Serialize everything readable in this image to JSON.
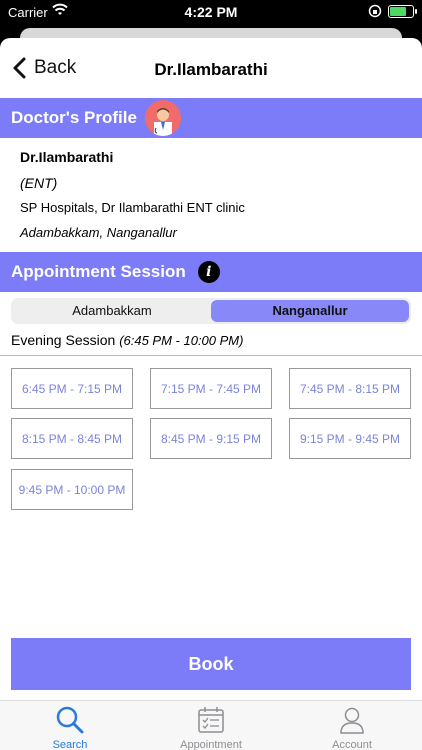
{
  "status_bar": {
    "carrier": "Carrier",
    "time": "4:22 PM"
  },
  "nav": {
    "back_label": "Back",
    "title": "Dr.Ilambarathi"
  },
  "profile_section": {
    "title": "Doctor's Profile"
  },
  "doctor": {
    "name": "Dr.Ilambarathi",
    "specialty": "(ENT)",
    "hospital": "SP Hospitals, Dr Ilambarathi ENT clinic",
    "locations": "Adambakkam, Nanganallur"
  },
  "appointment_section": {
    "title": "Appointment Session"
  },
  "location_tabs": [
    {
      "label": "Adambakkam",
      "selected": false
    },
    {
      "label": "Nanganallur",
      "selected": true
    }
  ],
  "session": {
    "name": "Evening Session",
    "range": "(6:45 PM - 10:00 PM)"
  },
  "slots": [
    "6:45 PM - 7:15 PM",
    "7:15 PM - 7:45 PM",
    "7:45 PM - 8:15 PM",
    "8:15 PM - 8:45 PM",
    "8:45 PM - 9:15 PM",
    "9:15 PM - 9:45 PM",
    "9:45 PM - 10:00 PM"
  ],
  "book_label": "Book",
  "tabbar": {
    "search": "Search",
    "appointment": "Appointment",
    "account": "Account",
    "active": "search"
  },
  "colors": {
    "accent": "#7c7cf8",
    "slot_text": "#7b84d8",
    "tab_active": "#2a7ad8"
  }
}
